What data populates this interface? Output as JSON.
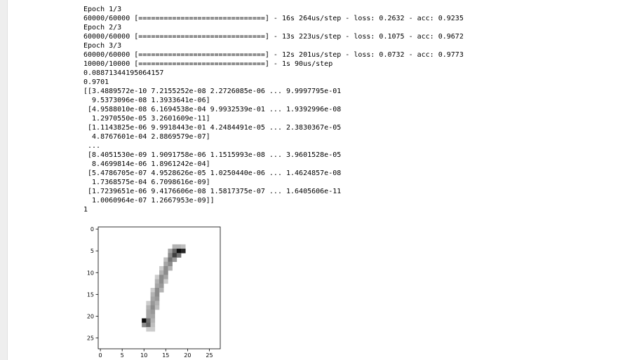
{
  "output": {
    "lines": [
      "Epoch 1/3",
      "60000/60000 [==============================] - 16s 264us/step - loss: 0.2632 - acc: 0.9235",
      "Epoch 2/3",
      "60000/60000 [==============================] - 13s 223us/step - loss: 0.1075 - acc: 0.9672",
      "Epoch 3/3",
      "60000/60000 [==============================] - 12s 201us/step - loss: 0.0732 - acc: 0.9773",
      "10000/10000 [==============================] - 1s 90us/step",
      "0.08871344195064157",
      "0.9701",
      "[[3.4889572e-10 7.2155252e-08 2.2726085e-06 ... 9.9997795e-01",
      "  9.5373096e-08 1.3933641e-06]",
      " [4.9588010e-08 6.1694538e-04 9.9932539e-01 ... 1.9392996e-08",
      "  1.2970550e-05 3.2601609e-11]",
      " [1.1143825e-06 9.9918443e-01 4.2484491e-05 ... 2.3830367e-05",
      "  4.8767601e-04 2.8869579e-07]",
      " ...",
      " [8.4051530e-09 1.9091758e-06 1.1515993e-08 ... 3.9601528e-05",
      "  8.4699814e-06 1.8961242e-04]",
      " [5.4786705e-07 4.9528626e-05 1.0250440e-06 ... 1.4624857e-08",
      "  1.7368575e-04 6.7098616e-09]",
      " [1.7239651e-06 9.4176606e-08 1.5817375e-07 ... 1.6405606e-11",
      "  1.0060964e-07 1.2667953e-09]]",
      "1"
    ]
  },
  "chart_data": {
    "type": "heatmap",
    "title": "",
    "xlabel": "",
    "ylabel": "",
    "colormap": "binary",
    "image_size": [
      28,
      28
    ],
    "xlim": [
      -0.5,
      27.5
    ],
    "ylim": [
      27.5,
      -0.5
    ],
    "x_ticks": [
      0,
      5,
      10,
      15,
      20,
      25
    ],
    "y_ticks": [
      0,
      5,
      10,
      15,
      20,
      25
    ],
    "x_tick_labels": [
      "0",
      "5",
      "10",
      "15",
      "20",
      "25"
    ],
    "y_tick_labels": [
      "0",
      "5",
      "10",
      "15",
      "20",
      "25"
    ],
    "pixels": [
      {
        "row": 4,
        "col": 17,
        "v": 0.3
      },
      {
        "row": 4,
        "col": 18,
        "v": 0.3
      },
      {
        "row": 4,
        "col": 19,
        "v": 0.25
      },
      {
        "row": 5,
        "col": 16,
        "v": 0.35
      },
      {
        "row": 5,
        "col": 17,
        "v": 0.6
      },
      {
        "row": 5,
        "col": 18,
        "v": 0.95
      },
      {
        "row": 5,
        "col": 19,
        "v": 0.85
      },
      {
        "row": 6,
        "col": 16,
        "v": 0.45
      },
      {
        "row": 6,
        "col": 17,
        "v": 0.75
      },
      {
        "row": 6,
        "col": 18,
        "v": 0.55
      },
      {
        "row": 7,
        "col": 15,
        "v": 0.25
      },
      {
        "row": 7,
        "col": 16,
        "v": 0.55
      },
      {
        "row": 7,
        "col": 17,
        "v": 0.4
      },
      {
        "row": 8,
        "col": 15,
        "v": 0.35
      },
      {
        "row": 8,
        "col": 16,
        "v": 0.45
      },
      {
        "row": 9,
        "col": 14,
        "v": 0.2
      },
      {
        "row": 9,
        "col": 15,
        "v": 0.45
      },
      {
        "row": 9,
        "col": 16,
        "v": 0.3
      },
      {
        "row": 10,
        "col": 14,
        "v": 0.3
      },
      {
        "row": 10,
        "col": 15,
        "v": 0.45
      },
      {
        "row": 11,
        "col": 13,
        "v": 0.2
      },
      {
        "row": 11,
        "col": 14,
        "v": 0.45
      },
      {
        "row": 11,
        "col": 15,
        "v": 0.35
      },
      {
        "row": 12,
        "col": 13,
        "v": 0.3
      },
      {
        "row": 12,
        "col": 14,
        "v": 0.45
      },
      {
        "row": 12,
        "col": 15,
        "v": 0.2
      },
      {
        "row": 13,
        "col": 13,
        "v": 0.35
      },
      {
        "row": 13,
        "col": 14,
        "v": 0.4
      },
      {
        "row": 14,
        "col": 12,
        "v": 0.2
      },
      {
        "row": 14,
        "col": 13,
        "v": 0.45
      },
      {
        "row": 14,
        "col": 14,
        "v": 0.3
      },
      {
        "row": 15,
        "col": 12,
        "v": 0.3
      },
      {
        "row": 15,
        "col": 13,
        "v": 0.45
      },
      {
        "row": 16,
        "col": 12,
        "v": 0.35
      },
      {
        "row": 16,
        "col": 13,
        "v": 0.4
      },
      {
        "row": 17,
        "col": 11,
        "v": 0.2
      },
      {
        "row": 17,
        "col": 12,
        "v": 0.4
      },
      {
        "row": 17,
        "col": 13,
        "v": 0.3
      },
      {
        "row": 18,
        "col": 11,
        "v": 0.3
      },
      {
        "row": 18,
        "col": 12,
        "v": 0.45
      },
      {
        "row": 18,
        "col": 13,
        "v": 0.25
      },
      {
        "row": 19,
        "col": 11,
        "v": 0.35
      },
      {
        "row": 19,
        "col": 12,
        "v": 0.4
      },
      {
        "row": 20,
        "col": 11,
        "v": 0.35
      },
      {
        "row": 20,
        "col": 12,
        "v": 0.35
      },
      {
        "row": 21,
        "col": 10,
        "v": 0.95
      },
      {
        "row": 21,
        "col": 11,
        "v": 0.55
      },
      {
        "row": 21,
        "col": 12,
        "v": 0.3
      },
      {
        "row": 22,
        "col": 10,
        "v": 0.45
      },
      {
        "row": 22,
        "col": 11,
        "v": 0.6
      },
      {
        "row": 22,
        "col": 12,
        "v": 0.25
      },
      {
        "row": 23,
        "col": 11,
        "v": 0.2
      },
      {
        "row": 23,
        "col": 12,
        "v": 0.2
      }
    ]
  }
}
